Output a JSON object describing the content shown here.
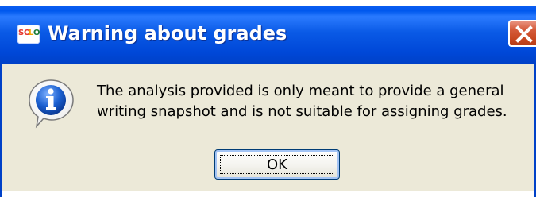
{
  "window": {
    "title": "Warning about grades",
    "app_icon_letters": [
      "S",
      "O",
      "L",
      "O"
    ],
    "close_glyph": "X"
  },
  "message": {
    "line1": "The analysis provided is only meant to provide a general",
    "line2": "writing snapshot and is not suitable for assigning grades."
  },
  "buttons": {
    "ok_label": "OK"
  },
  "icons": {
    "app": "solo-app-icon",
    "close": "close-icon",
    "info": "information-icon"
  },
  "colors": {
    "titlebar": "#0058ee",
    "dialog_bg": "#ece9d8",
    "close_button": "#d55b3a",
    "info_blue": "#1a5fd0"
  }
}
